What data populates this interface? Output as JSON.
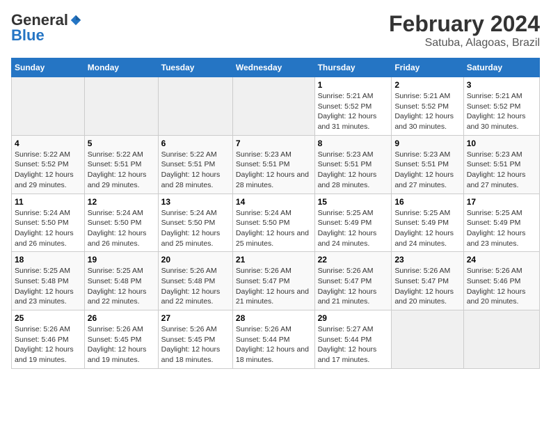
{
  "logo": {
    "general": "General",
    "blue": "Blue"
  },
  "title": "February 2024",
  "subtitle": "Satuba, Alagoas, Brazil",
  "days_of_week": [
    "Sunday",
    "Monday",
    "Tuesday",
    "Wednesday",
    "Thursday",
    "Friday",
    "Saturday"
  ],
  "weeks": [
    [
      {
        "day": "",
        "info": ""
      },
      {
        "day": "",
        "info": ""
      },
      {
        "day": "",
        "info": ""
      },
      {
        "day": "",
        "info": ""
      },
      {
        "day": "1",
        "info": "Sunrise: 5:21 AM\nSunset: 5:52 PM\nDaylight: 12 hours and 31 minutes."
      },
      {
        "day": "2",
        "info": "Sunrise: 5:21 AM\nSunset: 5:52 PM\nDaylight: 12 hours and 30 minutes."
      },
      {
        "day": "3",
        "info": "Sunrise: 5:21 AM\nSunset: 5:52 PM\nDaylight: 12 hours and 30 minutes."
      }
    ],
    [
      {
        "day": "4",
        "info": "Sunrise: 5:22 AM\nSunset: 5:52 PM\nDaylight: 12 hours and 29 minutes."
      },
      {
        "day": "5",
        "info": "Sunrise: 5:22 AM\nSunset: 5:51 PM\nDaylight: 12 hours and 29 minutes."
      },
      {
        "day": "6",
        "info": "Sunrise: 5:22 AM\nSunset: 5:51 PM\nDaylight: 12 hours and 28 minutes."
      },
      {
        "day": "7",
        "info": "Sunrise: 5:23 AM\nSunset: 5:51 PM\nDaylight: 12 hours and 28 minutes."
      },
      {
        "day": "8",
        "info": "Sunrise: 5:23 AM\nSunset: 5:51 PM\nDaylight: 12 hours and 28 minutes."
      },
      {
        "day": "9",
        "info": "Sunrise: 5:23 AM\nSunset: 5:51 PM\nDaylight: 12 hours and 27 minutes."
      },
      {
        "day": "10",
        "info": "Sunrise: 5:23 AM\nSunset: 5:51 PM\nDaylight: 12 hours and 27 minutes."
      }
    ],
    [
      {
        "day": "11",
        "info": "Sunrise: 5:24 AM\nSunset: 5:50 PM\nDaylight: 12 hours and 26 minutes."
      },
      {
        "day": "12",
        "info": "Sunrise: 5:24 AM\nSunset: 5:50 PM\nDaylight: 12 hours and 26 minutes."
      },
      {
        "day": "13",
        "info": "Sunrise: 5:24 AM\nSunset: 5:50 PM\nDaylight: 12 hours and 25 minutes."
      },
      {
        "day": "14",
        "info": "Sunrise: 5:24 AM\nSunset: 5:50 PM\nDaylight: 12 hours and 25 minutes."
      },
      {
        "day": "15",
        "info": "Sunrise: 5:25 AM\nSunset: 5:49 PM\nDaylight: 12 hours and 24 minutes."
      },
      {
        "day": "16",
        "info": "Sunrise: 5:25 AM\nSunset: 5:49 PM\nDaylight: 12 hours and 24 minutes."
      },
      {
        "day": "17",
        "info": "Sunrise: 5:25 AM\nSunset: 5:49 PM\nDaylight: 12 hours and 23 minutes."
      }
    ],
    [
      {
        "day": "18",
        "info": "Sunrise: 5:25 AM\nSunset: 5:48 PM\nDaylight: 12 hours and 23 minutes."
      },
      {
        "day": "19",
        "info": "Sunrise: 5:25 AM\nSunset: 5:48 PM\nDaylight: 12 hours and 22 minutes."
      },
      {
        "day": "20",
        "info": "Sunrise: 5:26 AM\nSunset: 5:48 PM\nDaylight: 12 hours and 22 minutes."
      },
      {
        "day": "21",
        "info": "Sunrise: 5:26 AM\nSunset: 5:47 PM\nDaylight: 12 hours and 21 minutes."
      },
      {
        "day": "22",
        "info": "Sunrise: 5:26 AM\nSunset: 5:47 PM\nDaylight: 12 hours and 21 minutes."
      },
      {
        "day": "23",
        "info": "Sunrise: 5:26 AM\nSunset: 5:47 PM\nDaylight: 12 hours and 20 minutes."
      },
      {
        "day": "24",
        "info": "Sunrise: 5:26 AM\nSunset: 5:46 PM\nDaylight: 12 hours and 20 minutes."
      }
    ],
    [
      {
        "day": "25",
        "info": "Sunrise: 5:26 AM\nSunset: 5:46 PM\nDaylight: 12 hours and 19 minutes."
      },
      {
        "day": "26",
        "info": "Sunrise: 5:26 AM\nSunset: 5:45 PM\nDaylight: 12 hours and 19 minutes."
      },
      {
        "day": "27",
        "info": "Sunrise: 5:26 AM\nSunset: 5:45 PM\nDaylight: 12 hours and 18 minutes."
      },
      {
        "day": "28",
        "info": "Sunrise: 5:26 AM\nSunset: 5:44 PM\nDaylight: 12 hours and 18 minutes."
      },
      {
        "day": "29",
        "info": "Sunrise: 5:27 AM\nSunset: 5:44 PM\nDaylight: 12 hours and 17 minutes."
      },
      {
        "day": "",
        "info": ""
      },
      {
        "day": "",
        "info": ""
      }
    ]
  ]
}
